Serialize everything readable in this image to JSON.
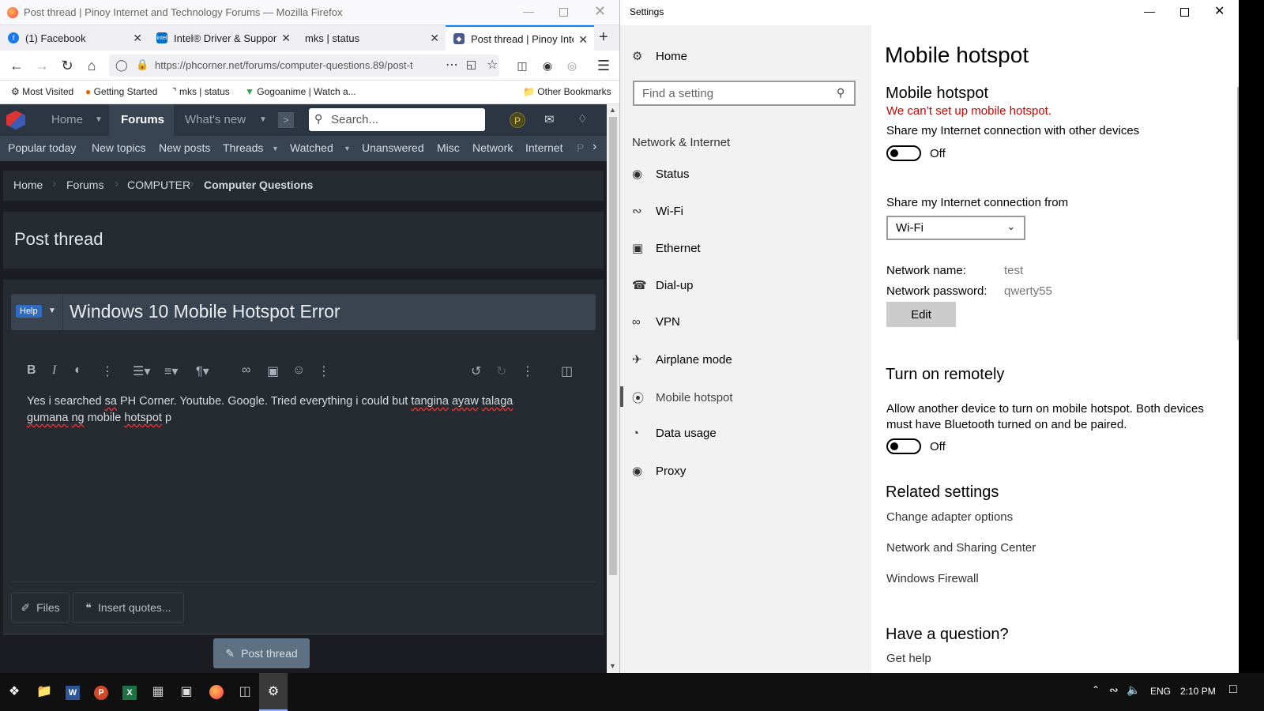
{
  "firefox": {
    "window_title": "Post thread | Pinoy Internet and Technology Forums — Mozilla Firefox",
    "tabs": [
      {
        "label": "(1) Facebook"
      },
      {
        "label": "Intel® Driver & Support"
      },
      {
        "label": "mks | status"
      },
      {
        "label": "Post thread | Pinoy Inter"
      }
    ],
    "url": "https://phcorner.net/forums/computer-questions.89/post-t",
    "bookmarks": [
      "Most Visited",
      "Getting Started",
      "mks | status",
      "Gogoanime | Watch a..."
    ],
    "other_bookmarks": "Other Bookmarks"
  },
  "forum": {
    "nav": {
      "home": "Home",
      "forums": "Forums",
      "whats_new": "What's new"
    },
    "search_placeholder": "Search...",
    "avatar_letter": "P",
    "subnav": [
      "Popular today",
      "New topics",
      "New posts",
      "Threads",
      "Watched",
      "Unanswered",
      "Misc",
      "Network",
      "Internet",
      "P"
    ],
    "breadcrumb": [
      "Home",
      "Forums",
      "COMPUTER",
      "Computer Questions"
    ],
    "page_title": "Post thread",
    "prefix": "Help",
    "thread_title": "Windows 10 Mobile Hotspot Error",
    "body_text": {
      "w1": "Yes i searched ",
      "w2": "sa",
      "w3": " PH Corner. Youtube. Google.  Tried everything i could but ",
      "w4": "tangina",
      "w5": " ",
      "w6": "ayaw",
      "w7": " ",
      "w8": "talaga",
      "w9": "gumana",
      "w10": " ",
      "w11": "ng",
      "w12": " mobile ",
      "w13": "hotspot",
      "w14": " p"
    },
    "files_label": "Files",
    "insert_quotes_label": "Insert quotes...",
    "post_button": "Post thread"
  },
  "settings": {
    "window_title": "Settings",
    "home": "Home",
    "search_placeholder": "Find a setting",
    "section": "Network & Internet",
    "nav": [
      {
        "label": "Status",
        "icon": "globe-icon"
      },
      {
        "label": "Wi-Fi",
        "icon": "wifi-icon"
      },
      {
        "label": "Ethernet",
        "icon": "ethernet-icon"
      },
      {
        "label": "Dial-up",
        "icon": "dialup-icon"
      },
      {
        "label": "VPN",
        "icon": "vpn-icon"
      },
      {
        "label": "Airplane mode",
        "icon": "airplane-icon"
      },
      {
        "label": "Mobile hotspot",
        "icon": "hotspot-icon"
      },
      {
        "label": "Data usage",
        "icon": "data-usage-icon"
      },
      {
        "label": "Proxy",
        "icon": "globe-icon"
      }
    ],
    "page_title": "Mobile hotspot",
    "section_title": "Mobile hotspot",
    "error": "We can’t set up mobile hotspot.",
    "share_label": "Share my Internet connection with other devices",
    "share_state": "Off",
    "share_from_label": "Share my Internet connection from",
    "share_from_value": "Wi-Fi",
    "network_name_label": "Network name:",
    "network_name": "test",
    "network_password_label": "Network password:",
    "network_password": "qwerty55",
    "edit_button": "Edit",
    "remote_title": "Turn on remotely",
    "remote_desc": "Allow another device to turn on mobile hotspot. Both devices must have Bluetooth turned on and be paired.",
    "remote_state": "Off",
    "related_title": "Related settings",
    "related": [
      "Change adapter options",
      "Network and Sharing Center",
      "Windows Firewall"
    ],
    "question_title": "Have a question?",
    "get_help": "Get help"
  },
  "taskbar": {
    "lang": "ENG",
    "time": "2:10 PM"
  },
  "colors": {
    "forum_bg": "#1b1d22",
    "forum_nav": "#2b3642",
    "error_red": "#c50500",
    "accent_blue": "#0a84ff"
  }
}
